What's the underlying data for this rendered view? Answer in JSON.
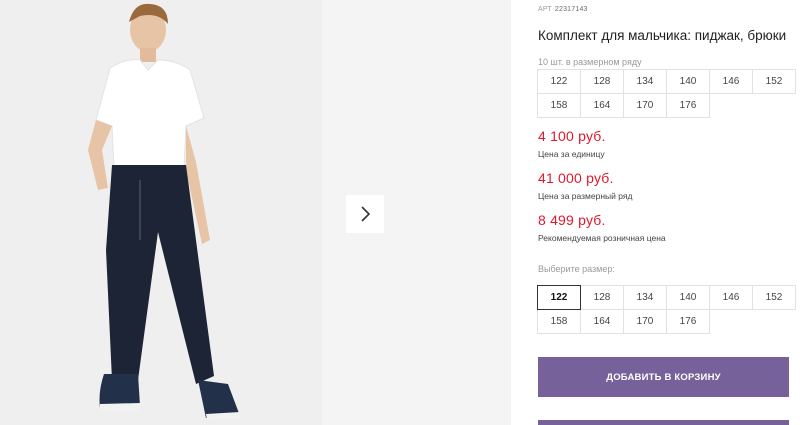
{
  "product": {
    "art_label": "АРТ",
    "art_code": "22317143",
    "title": "Комплект для мальчика: пиджак, брюки"
  },
  "size_row": {
    "hint": "10 шт. в размерном ряду",
    "sizes": [
      "122",
      "128",
      "134",
      "140",
      "146",
      "152",
      "158",
      "164",
      "170",
      "176"
    ]
  },
  "prices": {
    "unit_price": "4 100 руб.",
    "unit_label": "Цена за единицу",
    "row_price": "41 000 руб.",
    "row_label": "Цена за размерный ряд",
    "retail_price": "8 499 руб.",
    "retail_label": "Рекомендуемая розничная цена"
  },
  "size_select": {
    "hint": "Выберите размер:",
    "sizes": [
      "122",
      "128",
      "134",
      "140",
      "146",
      "152",
      "158",
      "164",
      "170",
      "176"
    ],
    "selected": "122"
  },
  "actions": {
    "add_to_cart": "ДОБАВИТЬ В КОРЗИНУ"
  },
  "icons": {
    "next": "chevron-right-icon"
  },
  "colors": {
    "price_red": "#e0182d",
    "button_purple": "#76619a"
  }
}
